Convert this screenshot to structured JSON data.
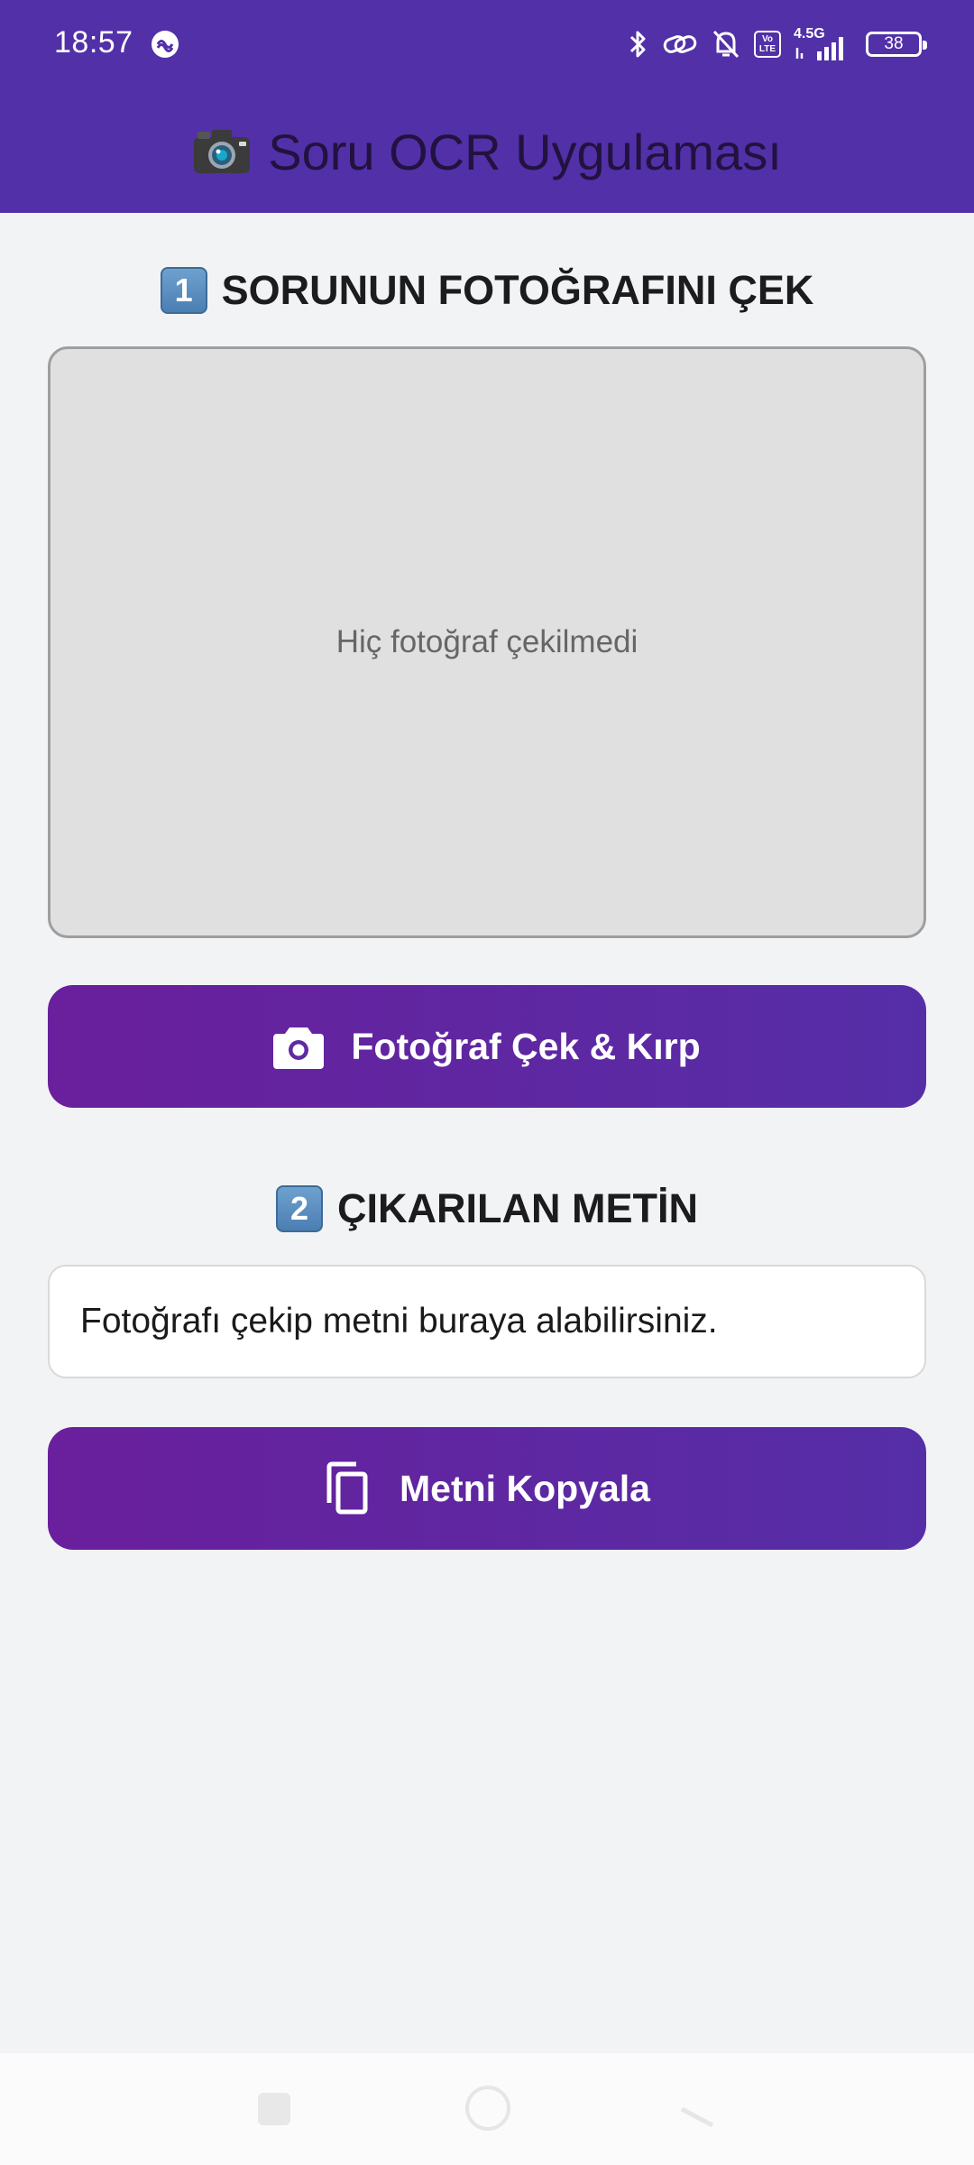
{
  "status_bar": {
    "time": "18:57",
    "network_label": "4.5G",
    "volte_label": "Vo LTE",
    "battery_level": "38",
    "icons": [
      "app-notification-icon",
      "bluetooth-icon",
      "link-icon",
      "bell-muted-icon",
      "volte-icon",
      "signal-icon",
      "battery-icon"
    ]
  },
  "app_bar": {
    "title": "Soru OCR Uygulaması",
    "icon": "camera-icon"
  },
  "section1": {
    "number": "1",
    "title": "SORUNUN FOTOĞRAFINI ÇEK"
  },
  "photo_preview": {
    "placeholder": "Hiç fotoğraf çekilmedi"
  },
  "capture_button": {
    "label": "Fotoğraf Çek & Kırp",
    "icon": "camera-icon"
  },
  "section2": {
    "number": "2",
    "title": "ÇIKARILAN METİN"
  },
  "text_output": {
    "value": "Fotoğrafı çekip metni buraya alabilirsiniz."
  },
  "copy_button": {
    "label": "Metni Kopyala",
    "icon": "copy-icon"
  },
  "nav_bar": {
    "buttons": [
      "recents-button",
      "home-button",
      "back-button"
    ]
  },
  "colors": {
    "primary": "#5230a8",
    "button_gradient_start": "#6a1f9c",
    "button_gradient_end": "#552ea7",
    "background": "#f2f3f5",
    "photo_box": "#e0e0e0"
  }
}
